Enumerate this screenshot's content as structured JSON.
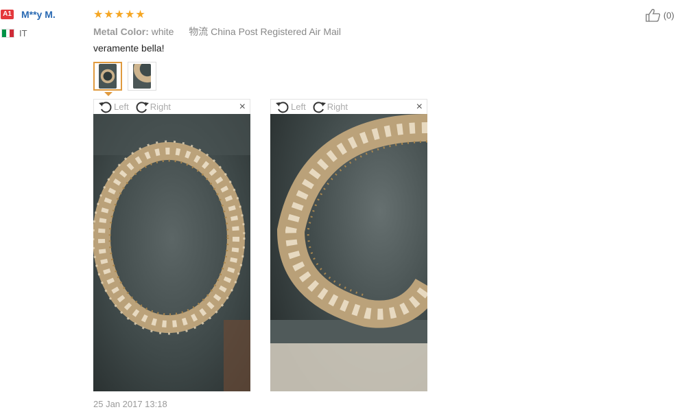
{
  "user": {
    "level_badge": "A1",
    "name": "M**y M.",
    "country": "IT",
    "flag_colors": [
      "#009246",
      "#ffffff",
      "#ce2b37"
    ]
  },
  "rating": {
    "stars": 5,
    "max": 5,
    "star_glyph": "★"
  },
  "meta": {
    "color_label": "Metal Color:",
    "color_value": "white",
    "shipping_label": "物流",
    "shipping_value": "China Post Registered Air Mail"
  },
  "review": {
    "text": "veramente bella!"
  },
  "helpful": {
    "count": "(0)"
  },
  "viewer": {
    "rotate_left": "Left",
    "rotate_right": "Right",
    "close": "×"
  },
  "timestamp": "25 Jan 2017 13:18",
  "colors": {
    "accent": "#f5a623",
    "name_blue": "#2a6ab3",
    "badge_red": "#e4393c",
    "thumb_active": "#e09a3e"
  }
}
